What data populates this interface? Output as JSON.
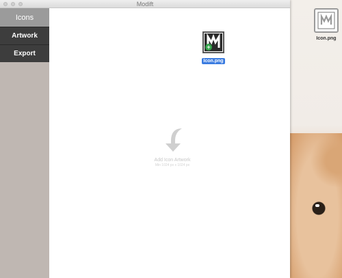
{
  "window": {
    "title": "Modift"
  },
  "sidebar": {
    "tabs": [
      {
        "label": "Icons",
        "active": true
      },
      {
        "label": "Artwork",
        "active": false
      },
      {
        "label": "Export",
        "active": false
      }
    ]
  },
  "main": {
    "file": {
      "label": "Icon.png",
      "icon": "image-file-icon",
      "badge": "+"
    },
    "dropzone": {
      "title": "Add Icon Artwork",
      "subtitle": "Min 1024 px x 1024 px",
      "icon": "curved-down-arrow-icon"
    }
  },
  "desktop": {
    "file": {
      "label": "Icon.png",
      "icon": "image-file-icon"
    }
  },
  "colors": {
    "accent": "#3a7be0",
    "sidebar": "#bfb7b2",
    "tab_dark": "#3d3d3d"
  }
}
